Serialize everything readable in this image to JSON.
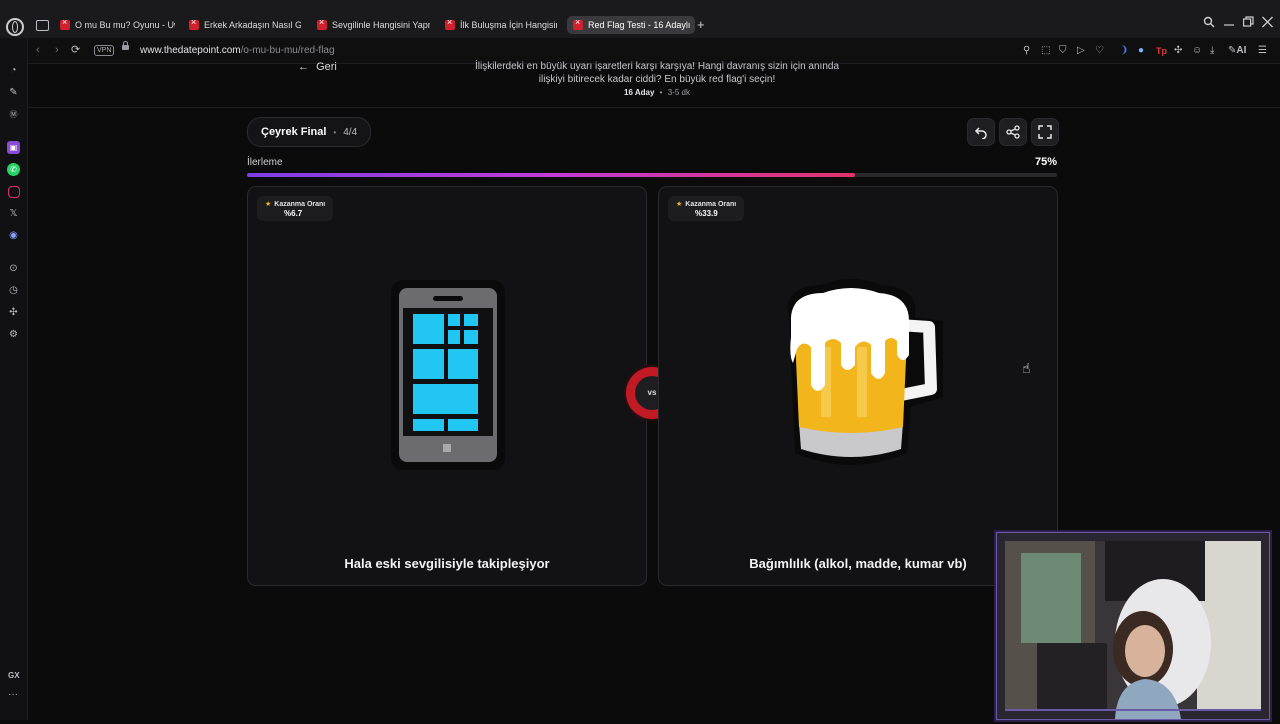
{
  "browser": {
    "tabs": [
      {
        "label": "O mu Bu mu? Oyunu - Uw",
        "active": false
      },
      {
        "label": "Erkek Arkadaşın Nasıl Giyi",
        "active": false
      },
      {
        "label": "Sevgilinle Hangisini Yapm",
        "active": false
      },
      {
        "label": "İlk Buluşma İçin Hangisini",
        "active": false
      },
      {
        "label": "Red Flag Testi - 16 Adaylı",
        "active": true
      }
    ],
    "new_tab_label": "+",
    "vpn_label": "VPN",
    "url_host": "www.thedatepoint.com",
    "url_path": "/o-mu-bu-mu/red-flag",
    "ai_label": "AI"
  },
  "sidebar": {
    "gx_label": "GX"
  },
  "header": {
    "back_label": "Geri",
    "intro": "İlişkilerdeki en büyük uyarı işaretleri karşı karşıya! Hangi davranış sizin için anında ilişkiyi bitirecek kadar ciddi? En büyük red flag'i seçin!",
    "candidates": "16 Aday",
    "duration": "3-5 dk",
    "separator": "•"
  },
  "round": {
    "title": "Çeyrek Final",
    "separator": "•",
    "count": "4/4"
  },
  "progress": {
    "label": "İlerleme",
    "value_text": "75%",
    "percent": 75
  },
  "cards": [
    {
      "win_label": "Kazanma Oranı",
      "win_rate": "%6.7",
      "label": "Hala eski sevgilisiyle takipleşiyor",
      "icon": "mobile-phone-icon"
    },
    {
      "win_label": "Kazanma Oranı",
      "win_rate": "%33.9",
      "label": "Bağımlılık (alkol, madde, kumar vb)",
      "icon": "beer-mug-icon"
    }
  ],
  "vs_label": "vs",
  "colors": {
    "accent_start": "#7b3fe4",
    "accent_end": "#e2336b",
    "vs_ring": "#c11a25",
    "star": "#f2b51c"
  }
}
